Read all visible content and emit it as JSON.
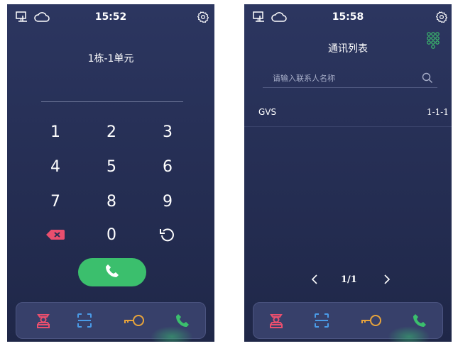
{
  "left_screen": {
    "status": {
      "time": "15:52",
      "icons": [
        "monitor-icon",
        "cloud-icon",
        "settings-icon"
      ]
    },
    "unit_label": "1栋-1单元",
    "dialpad": {
      "keys": [
        "1",
        "2",
        "3",
        "4",
        "5",
        "6",
        "7",
        "8",
        "9",
        "0"
      ],
      "backspace_icon": "backspace-icon",
      "reset_icon": "refresh-icon",
      "call_icon": "phone-icon"
    },
    "bottom_nav": [
      {
        "icon": "guard-icon",
        "color": "#e94f6e"
      },
      {
        "icon": "qr-scan-icon",
        "color": "#4a9be8"
      },
      {
        "icon": "key-icon",
        "color": "#e8a43b"
      },
      {
        "icon": "phone-icon",
        "color": "#3bbf6d",
        "active": true
      }
    ]
  },
  "right_screen": {
    "status": {
      "time": "15:58",
      "icons": [
        "monitor-icon",
        "cloud-icon",
        "settings-icon"
      ]
    },
    "title": "通讯列表",
    "keypad_toggle_icon": "dialpad-icon",
    "search": {
      "placeholder": "请输入联系人名称"
    },
    "contacts": [
      {
        "name": "GVS",
        "room": "1-1-1"
      }
    ],
    "pagination": {
      "label": "1/1"
    },
    "bottom_nav": [
      {
        "icon": "guard-icon",
        "color": "#e94f6e"
      },
      {
        "icon": "qr-scan-icon",
        "color": "#4a9be8"
      },
      {
        "icon": "key-icon",
        "color": "#e8a43b"
      },
      {
        "icon": "phone-icon",
        "color": "#3bbf6d",
        "active": true
      }
    ]
  },
  "colors": {
    "accent": "#3bbf6d",
    "background": "#262f55",
    "danger": "#e94f6e",
    "key": "#e8a43b",
    "scan": "#4a9be8"
  }
}
